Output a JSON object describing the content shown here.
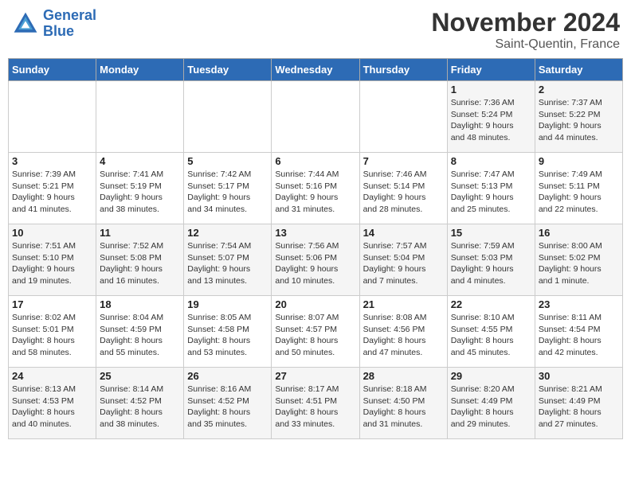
{
  "logo": {
    "line1": "General",
    "line2": "Blue"
  },
  "title": "November 2024",
  "location": "Saint-Quentin, France",
  "days_of_week": [
    "Sunday",
    "Monday",
    "Tuesday",
    "Wednesday",
    "Thursday",
    "Friday",
    "Saturday"
  ],
  "weeks": [
    [
      {
        "day": "",
        "info": ""
      },
      {
        "day": "",
        "info": ""
      },
      {
        "day": "",
        "info": ""
      },
      {
        "day": "",
        "info": ""
      },
      {
        "day": "",
        "info": ""
      },
      {
        "day": "1",
        "info": "Sunrise: 7:36 AM\nSunset: 5:24 PM\nDaylight: 9 hours\nand 48 minutes."
      },
      {
        "day": "2",
        "info": "Sunrise: 7:37 AM\nSunset: 5:22 PM\nDaylight: 9 hours\nand 44 minutes."
      }
    ],
    [
      {
        "day": "3",
        "info": "Sunrise: 7:39 AM\nSunset: 5:21 PM\nDaylight: 9 hours\nand 41 minutes."
      },
      {
        "day": "4",
        "info": "Sunrise: 7:41 AM\nSunset: 5:19 PM\nDaylight: 9 hours\nand 38 minutes."
      },
      {
        "day": "5",
        "info": "Sunrise: 7:42 AM\nSunset: 5:17 PM\nDaylight: 9 hours\nand 34 minutes."
      },
      {
        "day": "6",
        "info": "Sunrise: 7:44 AM\nSunset: 5:16 PM\nDaylight: 9 hours\nand 31 minutes."
      },
      {
        "day": "7",
        "info": "Sunrise: 7:46 AM\nSunset: 5:14 PM\nDaylight: 9 hours\nand 28 minutes."
      },
      {
        "day": "8",
        "info": "Sunrise: 7:47 AM\nSunset: 5:13 PM\nDaylight: 9 hours\nand 25 minutes."
      },
      {
        "day": "9",
        "info": "Sunrise: 7:49 AM\nSunset: 5:11 PM\nDaylight: 9 hours\nand 22 minutes."
      }
    ],
    [
      {
        "day": "10",
        "info": "Sunrise: 7:51 AM\nSunset: 5:10 PM\nDaylight: 9 hours\nand 19 minutes."
      },
      {
        "day": "11",
        "info": "Sunrise: 7:52 AM\nSunset: 5:08 PM\nDaylight: 9 hours\nand 16 minutes."
      },
      {
        "day": "12",
        "info": "Sunrise: 7:54 AM\nSunset: 5:07 PM\nDaylight: 9 hours\nand 13 minutes."
      },
      {
        "day": "13",
        "info": "Sunrise: 7:56 AM\nSunset: 5:06 PM\nDaylight: 9 hours\nand 10 minutes."
      },
      {
        "day": "14",
        "info": "Sunrise: 7:57 AM\nSunset: 5:04 PM\nDaylight: 9 hours\nand 7 minutes."
      },
      {
        "day": "15",
        "info": "Sunrise: 7:59 AM\nSunset: 5:03 PM\nDaylight: 9 hours\nand 4 minutes."
      },
      {
        "day": "16",
        "info": "Sunrise: 8:00 AM\nSunset: 5:02 PM\nDaylight: 9 hours\nand 1 minute."
      }
    ],
    [
      {
        "day": "17",
        "info": "Sunrise: 8:02 AM\nSunset: 5:01 PM\nDaylight: 8 hours\nand 58 minutes."
      },
      {
        "day": "18",
        "info": "Sunrise: 8:04 AM\nSunset: 4:59 PM\nDaylight: 8 hours\nand 55 minutes."
      },
      {
        "day": "19",
        "info": "Sunrise: 8:05 AM\nSunset: 4:58 PM\nDaylight: 8 hours\nand 53 minutes."
      },
      {
        "day": "20",
        "info": "Sunrise: 8:07 AM\nSunset: 4:57 PM\nDaylight: 8 hours\nand 50 minutes."
      },
      {
        "day": "21",
        "info": "Sunrise: 8:08 AM\nSunset: 4:56 PM\nDaylight: 8 hours\nand 47 minutes."
      },
      {
        "day": "22",
        "info": "Sunrise: 8:10 AM\nSunset: 4:55 PM\nDaylight: 8 hours\nand 45 minutes."
      },
      {
        "day": "23",
        "info": "Sunrise: 8:11 AM\nSunset: 4:54 PM\nDaylight: 8 hours\nand 42 minutes."
      }
    ],
    [
      {
        "day": "24",
        "info": "Sunrise: 8:13 AM\nSunset: 4:53 PM\nDaylight: 8 hours\nand 40 minutes."
      },
      {
        "day": "25",
        "info": "Sunrise: 8:14 AM\nSunset: 4:52 PM\nDaylight: 8 hours\nand 38 minutes."
      },
      {
        "day": "26",
        "info": "Sunrise: 8:16 AM\nSunset: 4:52 PM\nDaylight: 8 hours\nand 35 minutes."
      },
      {
        "day": "27",
        "info": "Sunrise: 8:17 AM\nSunset: 4:51 PM\nDaylight: 8 hours\nand 33 minutes."
      },
      {
        "day": "28",
        "info": "Sunrise: 8:18 AM\nSunset: 4:50 PM\nDaylight: 8 hours\nand 31 minutes."
      },
      {
        "day": "29",
        "info": "Sunrise: 8:20 AM\nSunset: 4:49 PM\nDaylight: 8 hours\nand 29 minutes."
      },
      {
        "day": "30",
        "info": "Sunrise: 8:21 AM\nSunset: 4:49 PM\nDaylight: 8 hours\nand 27 minutes."
      }
    ]
  ]
}
